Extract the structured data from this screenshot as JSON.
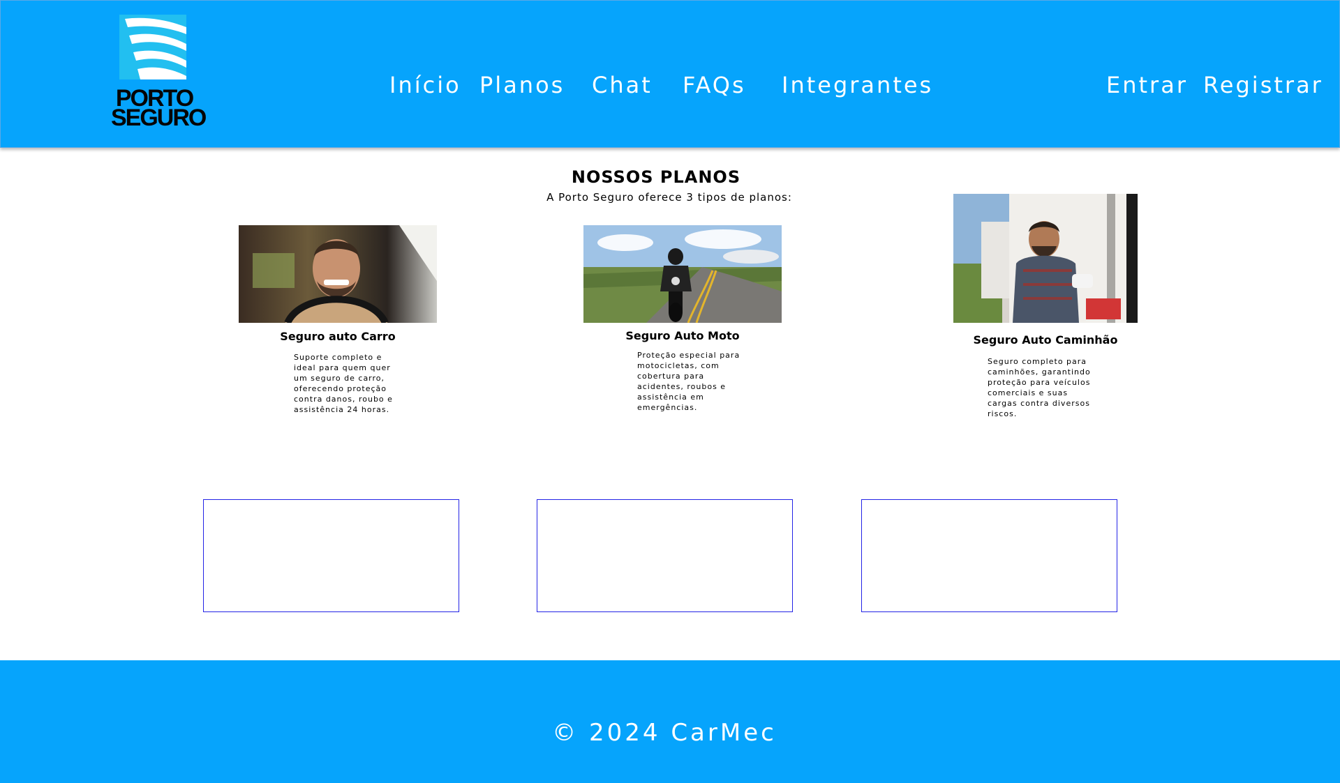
{
  "brand": {
    "name_line1": "PORTO",
    "name_line2": "SEGURO",
    "logo_icon": "sail-logo-icon",
    "color_primary": "#06a4fc"
  },
  "nav": {
    "inicio": "Início",
    "planos": "Planos",
    "chat": "Chat",
    "faqs": "FAQs",
    "integrantes": "Integrantes",
    "entrar": "Entrar",
    "registrar": "Registrar"
  },
  "plans": {
    "title": "NOSSOS PLANOS",
    "subtitle": "A Porto Seguro oferece 3 tipos de planos:",
    "cards": [
      {
        "title": "Seguro auto Carro",
        "description": "Suporte completo e ideal para quem quer um seguro de carro, oferecendo proteção contra danos, roubo e assistência 24 horas.",
        "image": "smiling-driver-in-car-photo"
      },
      {
        "title": "Seguro Auto Moto",
        "description": "Proteção especial para motocicletas, com cobertura para acidentes, roubos e assistência em emergências.",
        "image": "motorcycle-rider-on-road-photo"
      },
      {
        "title": "Seguro Auto Caminhão",
        "description": "Seguro completo para caminhões, garantindo proteção para veículos comerciais e suas cargas contra diversos riscos.",
        "image": "truck-driver-at-trailer-photo"
      }
    ]
  },
  "footer": {
    "copyright": "© 2024 CarMec"
  }
}
